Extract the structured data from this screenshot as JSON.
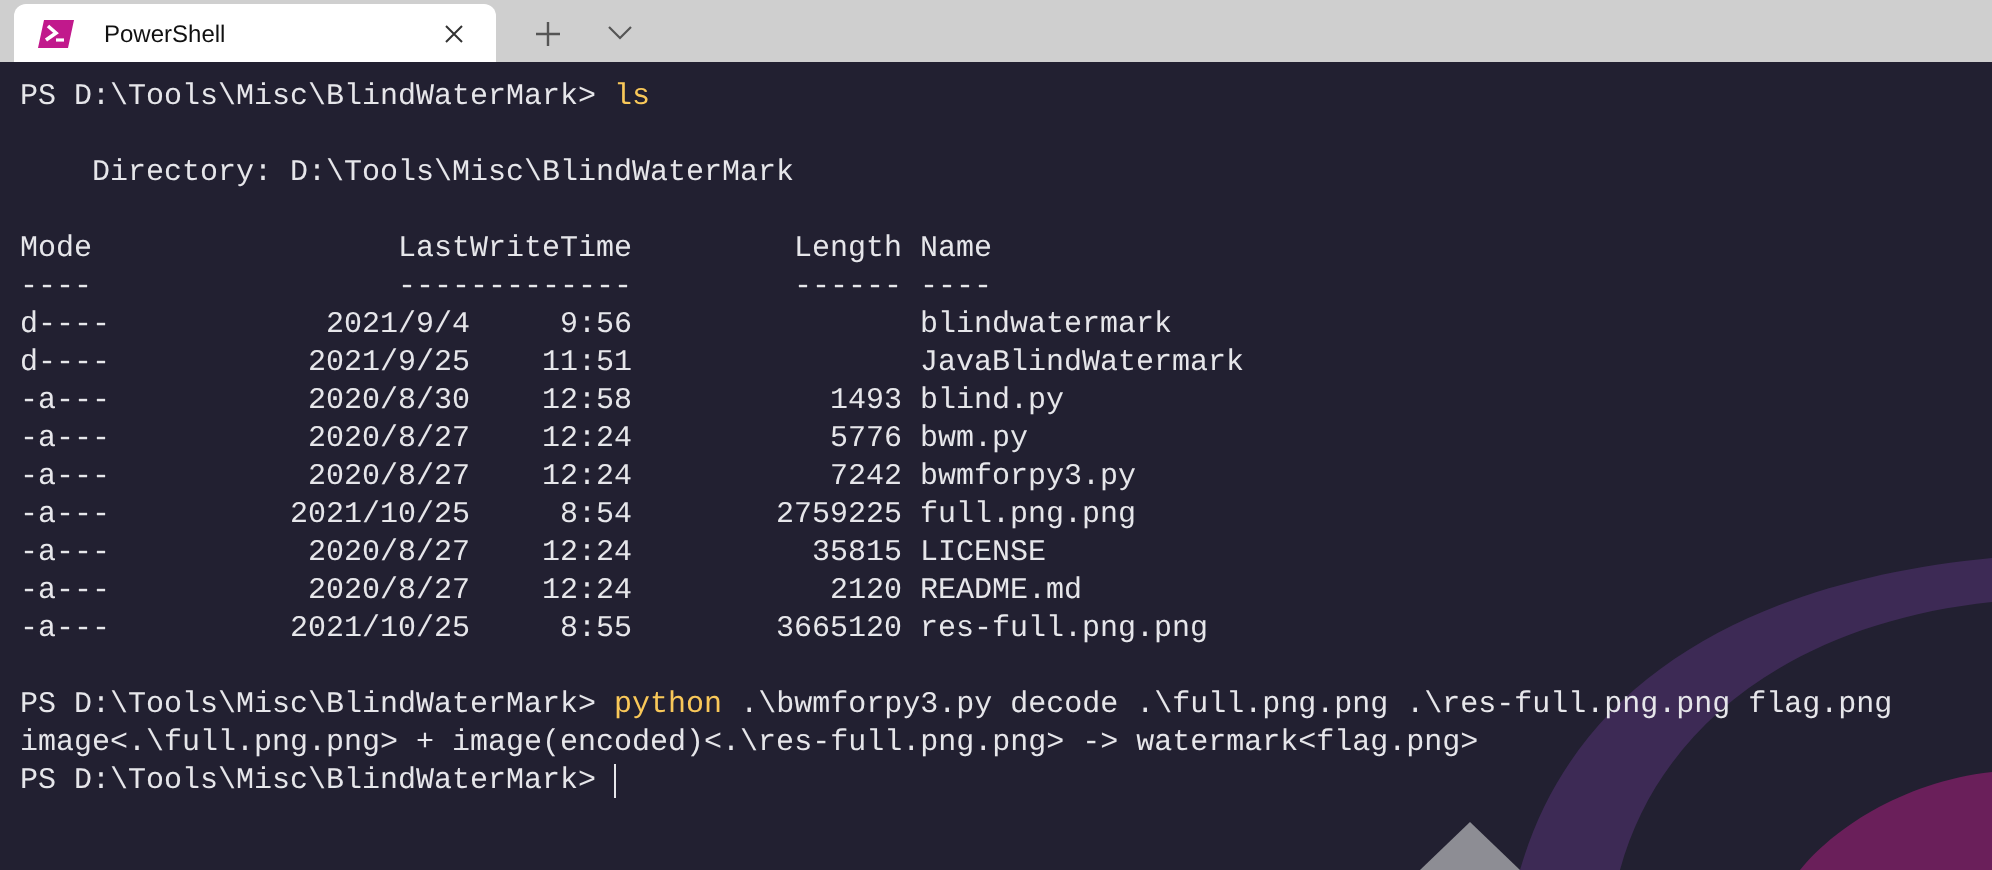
{
  "tab": {
    "title": "PowerShell",
    "selected": true
  },
  "terminal": {
    "first_command": {
      "prompt": "PS D:\\Tools\\Misc\\BlindWaterMark>",
      "command": "ls"
    },
    "directory": "    Directory: D:\\Tools\\Misc\\BlindWaterMark",
    "columns": [
      {
        "label": "Mode",
        "rule": "----"
      },
      {
        "label": "LastWriteTime",
        "rule": "-------------"
      },
      {
        "label": "Length",
        "rule": "------"
      },
      {
        "label": "Name",
        "rule": "----"
      }
    ],
    "rows": [
      {
        "mode": "d----",
        "date": "2021/9/4",
        "time": "9:56",
        "name": "blindwatermark"
      },
      {
        "mode": "d----",
        "date": "2021/9/25",
        "time": "11:51",
        "name": "JavaBlindWatermark"
      },
      {
        "mode": "-a---",
        "date": "2020/8/30",
        "time": "12:58",
        "length": "1493",
        "name": "blind.py"
      },
      {
        "mode": "-a---",
        "date": "2020/8/27",
        "time": "12:24",
        "length": "5776",
        "name": "bwm.py"
      },
      {
        "mode": "-a---",
        "date": "2020/8/27",
        "time": "12:24",
        "length": "7242",
        "name": "bwmforpy3.py"
      },
      {
        "mode": "-a---",
        "date": "2021/10/25",
        "time": "8:54",
        "length": "2759225",
        "name": "full.png.png"
      },
      {
        "mode": "-a---",
        "date": "2020/8/27",
        "time": "12:24",
        "length": "35815",
        "name": "LICENSE"
      },
      {
        "mode": "-a---",
        "date": "2020/8/27",
        "time": "12:24",
        "length": "2120",
        "name": "README.md"
      },
      {
        "mode": "-a---",
        "date": "2021/10/25",
        "time": "8:55",
        "length": "3665120",
        "name": "res-full.png.png"
      }
    ],
    "second_command": {
      "prompt": "PS D:\\Tools\\Misc\\BlindWaterMark>",
      "command": "python",
      "args": ".\\bwmforpy3.py decode .\\full.png.png .\\res-full.png.png flag.png"
    },
    "output": "image<.\\full.png.png> + image(encoded)<.\\res-full.png.png> -> watermark<flag.png>",
    "current_prompt": "PS D:\\Tools\\Misc\\BlindWaterMark>"
  }
}
